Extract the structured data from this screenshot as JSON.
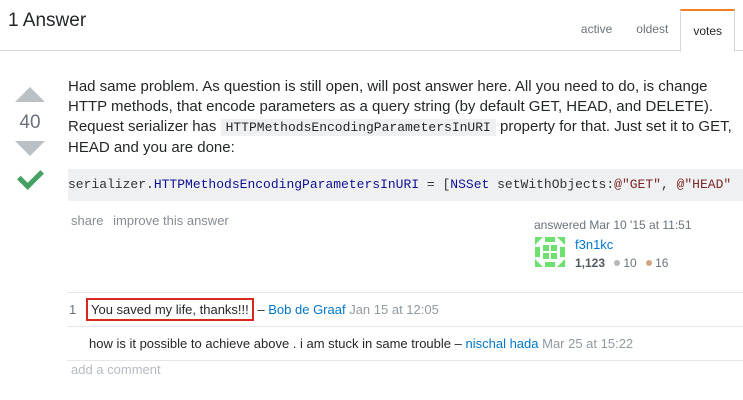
{
  "header": {
    "title": "1 Answer",
    "tabs": [
      {
        "label": "active"
      },
      {
        "label": "oldest"
      },
      {
        "label": "votes"
      }
    ],
    "active_tab": "votes"
  },
  "answer": {
    "score": "40",
    "accepted": true,
    "body": {
      "p1_part1": "Had same problem. As question is still open, will post answer here. All you need to do, is change HTTP methods, that encode parameters as a query string (by default GET, HEAD, and DELETE). Request serializer has ",
      "inline_code": "HTTPMethodsEncodingParametersInURI",
      "p1_part2": " property for that. Just set it to GET, HEAD and you are done:",
      "code": {
        "t1": "serializer.",
        "t2": "HTTPMethodsEncodingParametersInURI",
        "t3": " = [",
        "t4": "NSSet",
        "t5": " setWithObjects:",
        "t6": "@\"GET\"",
        "t7": ", ",
        "t8": "@\"HEAD\""
      }
    },
    "menu": {
      "share": "share",
      "improve": "improve this answer"
    },
    "signature": {
      "answered": "answered Mar 10 '15 at 11:51",
      "username": "f3n1kc",
      "reputation": "1,123",
      "silver": "10",
      "bronze": "16",
      "silver_color": "#b4b8bc",
      "bronze_color": "#d1a684"
    }
  },
  "comments": [
    {
      "score": "1",
      "text": "You saved my life, thanks!!!",
      "sep": " – ",
      "user": "Bob de Graaf",
      "date": "Jan 15 at 12:05"
    },
    {
      "score": "",
      "text": "how is it possible to achieve above . i am stuck in same trouble",
      "sep": " – ",
      "user": "nischal hada",
      "date": "Mar 25 at 15:22"
    }
  ],
  "add_comment": "add a comment",
  "colors": {
    "accent": "#f48024",
    "link": "#0077cc",
    "accepted": "#45a163",
    "highlight": "#d8291f"
  }
}
